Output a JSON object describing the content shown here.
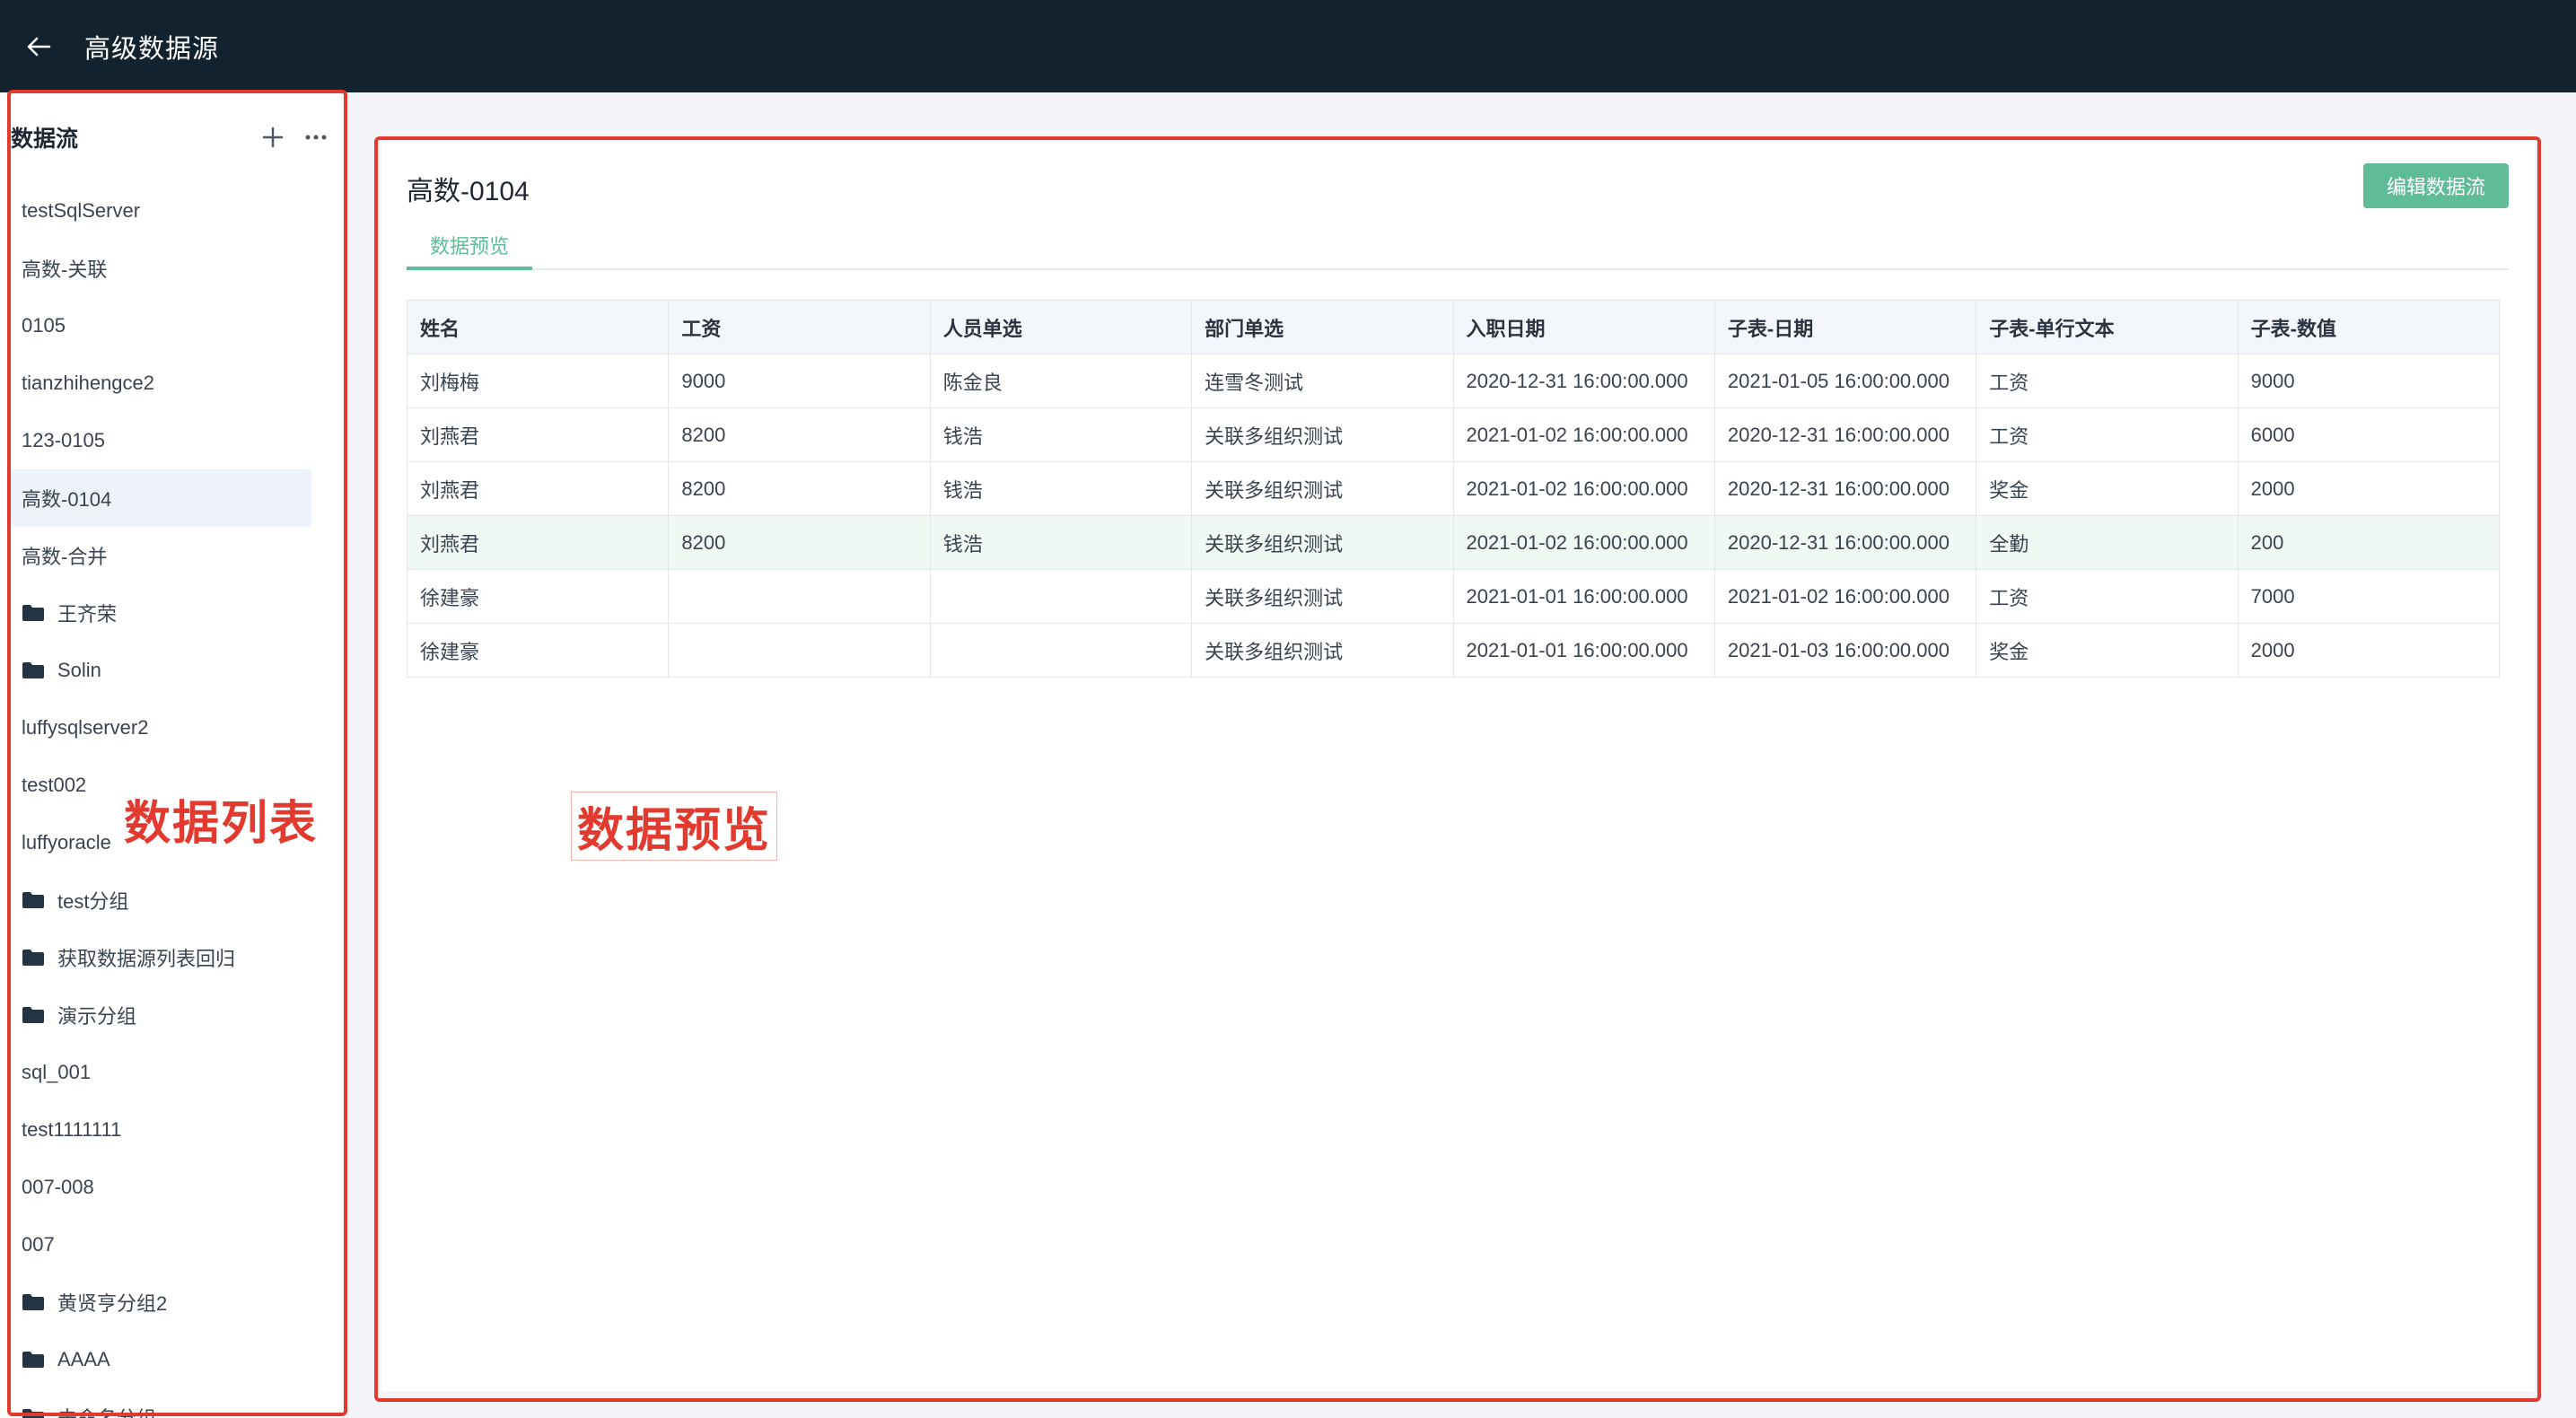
{
  "app": {
    "title": "高级数据源"
  },
  "sidebar": {
    "title": "数据流",
    "items": [
      {
        "label": "testSqlServer",
        "type": "item"
      },
      {
        "label": "高数-关联",
        "type": "item"
      },
      {
        "label": "0105",
        "type": "item"
      },
      {
        "label": "tianzhihengce2",
        "type": "item"
      },
      {
        "label": "123-0105",
        "type": "item"
      },
      {
        "label": "高数-0104",
        "type": "item",
        "active": true
      },
      {
        "label": "高数-合并",
        "type": "item"
      },
      {
        "label": "王齐荣",
        "type": "folder"
      },
      {
        "label": "Solin",
        "type": "folder"
      },
      {
        "label": "luffysqlserver2",
        "type": "item"
      },
      {
        "label": "test002",
        "type": "item"
      },
      {
        "label": "luffyoracle",
        "type": "item"
      },
      {
        "label": "test分组",
        "type": "folder"
      },
      {
        "label": "获取数据源列表回归",
        "type": "folder"
      },
      {
        "label": "演示分组",
        "type": "folder"
      },
      {
        "label": "sql_001",
        "type": "item"
      },
      {
        "label": "test1111111",
        "type": "item"
      },
      {
        "label": "007-008",
        "type": "item"
      },
      {
        "label": "007",
        "type": "item"
      },
      {
        "label": "黄贤亨分组2",
        "type": "folder"
      },
      {
        "label": "AAAA",
        "type": "folder"
      },
      {
        "label": "未命名分组",
        "type": "folder"
      }
    ]
  },
  "main": {
    "title": "高数-0104",
    "edit_button": "编辑数据流",
    "tabs": [
      {
        "label": "数据预览"
      }
    ],
    "table": {
      "columns": [
        "姓名",
        "工资",
        "人员单选",
        "部门单选",
        "入职日期",
        "子表-日期",
        "子表-单行文本",
        "子表-数值"
      ],
      "rows": [
        [
          "刘梅梅",
          "9000",
          "陈金良",
          "连雪冬测试",
          "2020-12-31 16:00:00.000",
          "2021-01-05 16:00:00.000",
          "工资",
          "9000"
        ],
        [
          "刘燕君",
          "8200",
          "钱浩",
          "关联多组织测试",
          "2021-01-02 16:00:00.000",
          "2020-12-31 16:00:00.000",
          "工资",
          "6000"
        ],
        [
          "刘燕君",
          "8200",
          "钱浩",
          "关联多组织测试",
          "2021-01-02 16:00:00.000",
          "2020-12-31 16:00:00.000",
          "奖金",
          "2000"
        ],
        [
          "刘燕君",
          "8200",
          "钱浩",
          "关联多组织测试",
          "2021-01-02 16:00:00.000",
          "2020-12-31 16:00:00.000",
          "全勤",
          "200"
        ],
        [
          "徐建豪",
          "",
          "",
          "关联多组织测试",
          "2021-01-01 16:00:00.000",
          "2021-01-02 16:00:00.000",
          "工资",
          "7000"
        ],
        [
          "徐建豪",
          "",
          "",
          "关联多组织测试",
          "2021-01-01 16:00:00.000",
          "2021-01-03 16:00:00.000",
          "奖金",
          "2000"
        ]
      ],
      "highlighted_row": 3
    }
  },
  "annotations": {
    "sidebar_label": "数据列表",
    "preview_label": "数据预览",
    "color": "#e23a2e"
  },
  "colors": {
    "topbar": "#13222f",
    "accent": "#5fbc97"
  }
}
